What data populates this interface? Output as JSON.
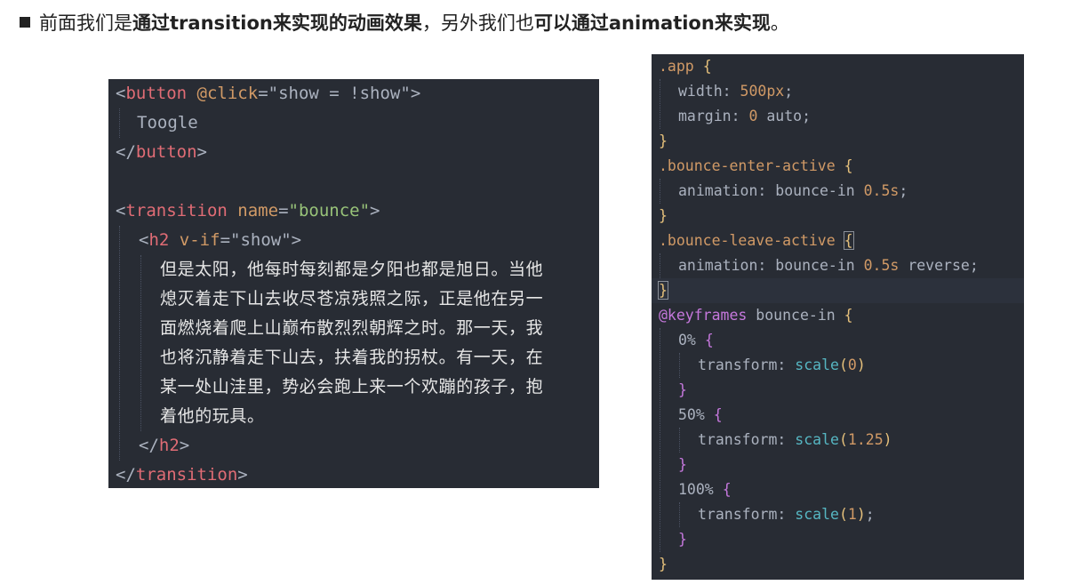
{
  "heading": {
    "part1": "前面我们是",
    "bold1": "通过transition来实现的动画效果",
    "part2": "，另外我们也",
    "bold2": "可以通过animation来实现",
    "part3": "。"
  },
  "template_code": {
    "l1": {
      "lt": "<",
      "tag": "button",
      "attr": "@click",
      "eq": "=",
      "q1": "\"",
      "val": "show = !show",
      "q2": "\"",
      "gt": ">"
    },
    "l2": "Toogle",
    "l3": {
      "lt": "</",
      "tag": "button",
      "gt": ">"
    },
    "l5": {
      "lt": "<",
      "tag": "transition",
      "attr": "name",
      "eq": "=",
      "val": "\"bounce\"",
      "gt": ">"
    },
    "l6": {
      "lt": "<",
      "tag": "h2",
      "attr": "v-if",
      "eq": "=",
      "val": "\"show\"",
      "gt": ">"
    },
    "text": [
      "但是太阳，他每时每刻都是夕阳也都是旭日。当他",
      "熄灭着走下山去收尽苍凉残照之际，正是他在另一",
      "面燃烧着爬上山巅布散烈烈朝辉之时。那一天，我",
      "也将沉静着走下山去，扶着我的拐杖。有一天，在",
      "某一处山洼里，势必会跑上来一个欢蹦的孩子，抱",
      "着他的玩具。"
    ],
    "l13": {
      "lt": "</",
      "tag": "h2",
      "gt": ">"
    },
    "l14": {
      "lt": "</",
      "tag": "transition",
      "gt": ">"
    }
  },
  "style_code": {
    "r1": {
      "sel": ".app",
      "br": "{"
    },
    "r2": {
      "prop": "width:",
      "val": "500px",
      "end": ";"
    },
    "r3": {
      "prop": "margin:",
      "val": "0",
      "rest": "auto;"
    },
    "r4": "}",
    "r5": {
      "sel": ".bounce-enter-active",
      "br": "{"
    },
    "r6": {
      "prop": "animation:",
      "name": "bounce-in",
      "dur": "0.5s",
      "end": ";"
    },
    "r7": "}",
    "r8": {
      "sel": ".bounce-leave-active",
      "br": "{"
    },
    "r9": {
      "prop": "animation:",
      "name": "bounce-in",
      "dur": "0.5s",
      "rest": "reverse;"
    },
    "r10": "}",
    "r11": {
      "at": "@keyframes",
      "name": "bounce-in",
      "br": "{"
    },
    "r12": {
      "pct": "0%",
      "br": "{"
    },
    "r13": {
      "prop": "transform:",
      "fn": "scale",
      "arg": "0"
    },
    "r14": "}",
    "r15": {
      "pct": "50%",
      "br": "{"
    },
    "r16": {
      "prop": "transform:",
      "fn": "scale",
      "arg": "1.25"
    },
    "r17": "}",
    "r18": {
      "pct": "100%",
      "br": "{"
    },
    "r19": {
      "prop": "transform:",
      "fn": "scale",
      "arg": "1",
      "end": ";"
    },
    "r20": "}",
    "r21": "}"
  },
  "colors": {
    "editor_bg": "#282c34",
    "tag": "#e06c75",
    "attribute": "#d19a66",
    "string": "#98c379",
    "function": "#56b6c2",
    "keyword": "#c678dd",
    "brace": "#e5c07b"
  }
}
